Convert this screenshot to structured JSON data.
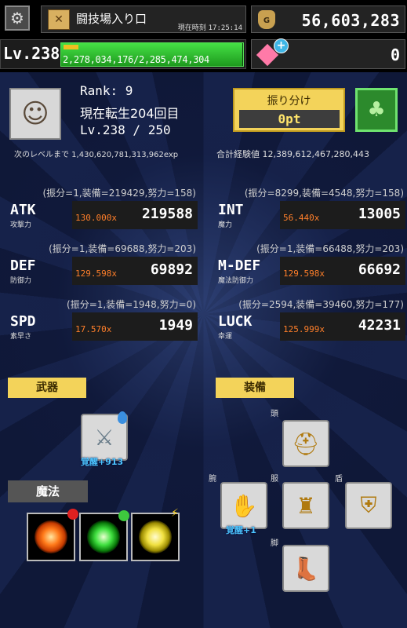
{
  "header": {
    "location_name": "闘技場入り口",
    "time_label": "現在時刻",
    "time_value": "17:25:14",
    "gold": "56,603,283",
    "gold_icon_letter": "G",
    "level_label": "Lv.238",
    "exp_text": "2,278,034,176/2,285,474,304",
    "exp_progress": 0.997,
    "gems": "0"
  },
  "profile": {
    "rank": "Rank: 9",
    "rebirth": "現在転生204回目",
    "level": "Lv.238 / 250",
    "next_level": "次のレベルまで 1,430,620,781,313,962exp",
    "total_exp": "合計経験値 12,389,612,467,280,443",
    "allocate_label": "振り分け",
    "allocate_points": "0pt"
  },
  "stats": [
    {
      "name": "ATK",
      "sub": "攻撃力",
      "note": "(振分=1,装備=219429,努力=158)",
      "mult": "130.000x",
      "value": "219588"
    },
    {
      "name": "INT",
      "sub": "魔力",
      "note": "(振分=8299,装備=4548,努力=158)",
      "mult": "56.440x",
      "value": "13005"
    },
    {
      "name": "DEF",
      "sub": "防御力",
      "note": "(振分=1,装備=69688,努力=203)",
      "mult": "129.598x",
      "value": "69892"
    },
    {
      "name": "M-DEF",
      "sub": "魔法防御力",
      "note": "(振分=1,装備=66488,努力=203)",
      "mult": "129.598x",
      "value": "66692"
    },
    {
      "name": "SPD",
      "sub": "素早さ",
      "note": "(振分=1,装備=1948,努力=0)",
      "mult": "17.570x",
      "value": "1949"
    },
    {
      "name": "LUCK",
      "sub": "幸運",
      "note": "(振分=2594,装備=39460,努力=177)",
      "mult": "125.999x",
      "value": "42231"
    }
  ],
  "sections": {
    "weapon": "武器",
    "equipment": "装備",
    "magic": "魔法"
  },
  "weapon": {
    "awaken": "覚醒+913"
  },
  "equipment": {
    "head": "頭",
    "arm": "腕",
    "body": "服",
    "shield": "盾",
    "leg": "脚",
    "arm_awaken": "覚醒+1"
  },
  "colors": {
    "accent_yellow": "#f3d35a",
    "exp_green": "#45e045",
    "multiplier_orange": "#ff7f2a",
    "awaken_blue": "#4cc6ff"
  },
  "icons": {
    "settings": "gear-icon",
    "location": "map-icon",
    "gold": "money-bag-icon",
    "gem": "gem-icon",
    "skill_tree": "tree-icon"
  }
}
